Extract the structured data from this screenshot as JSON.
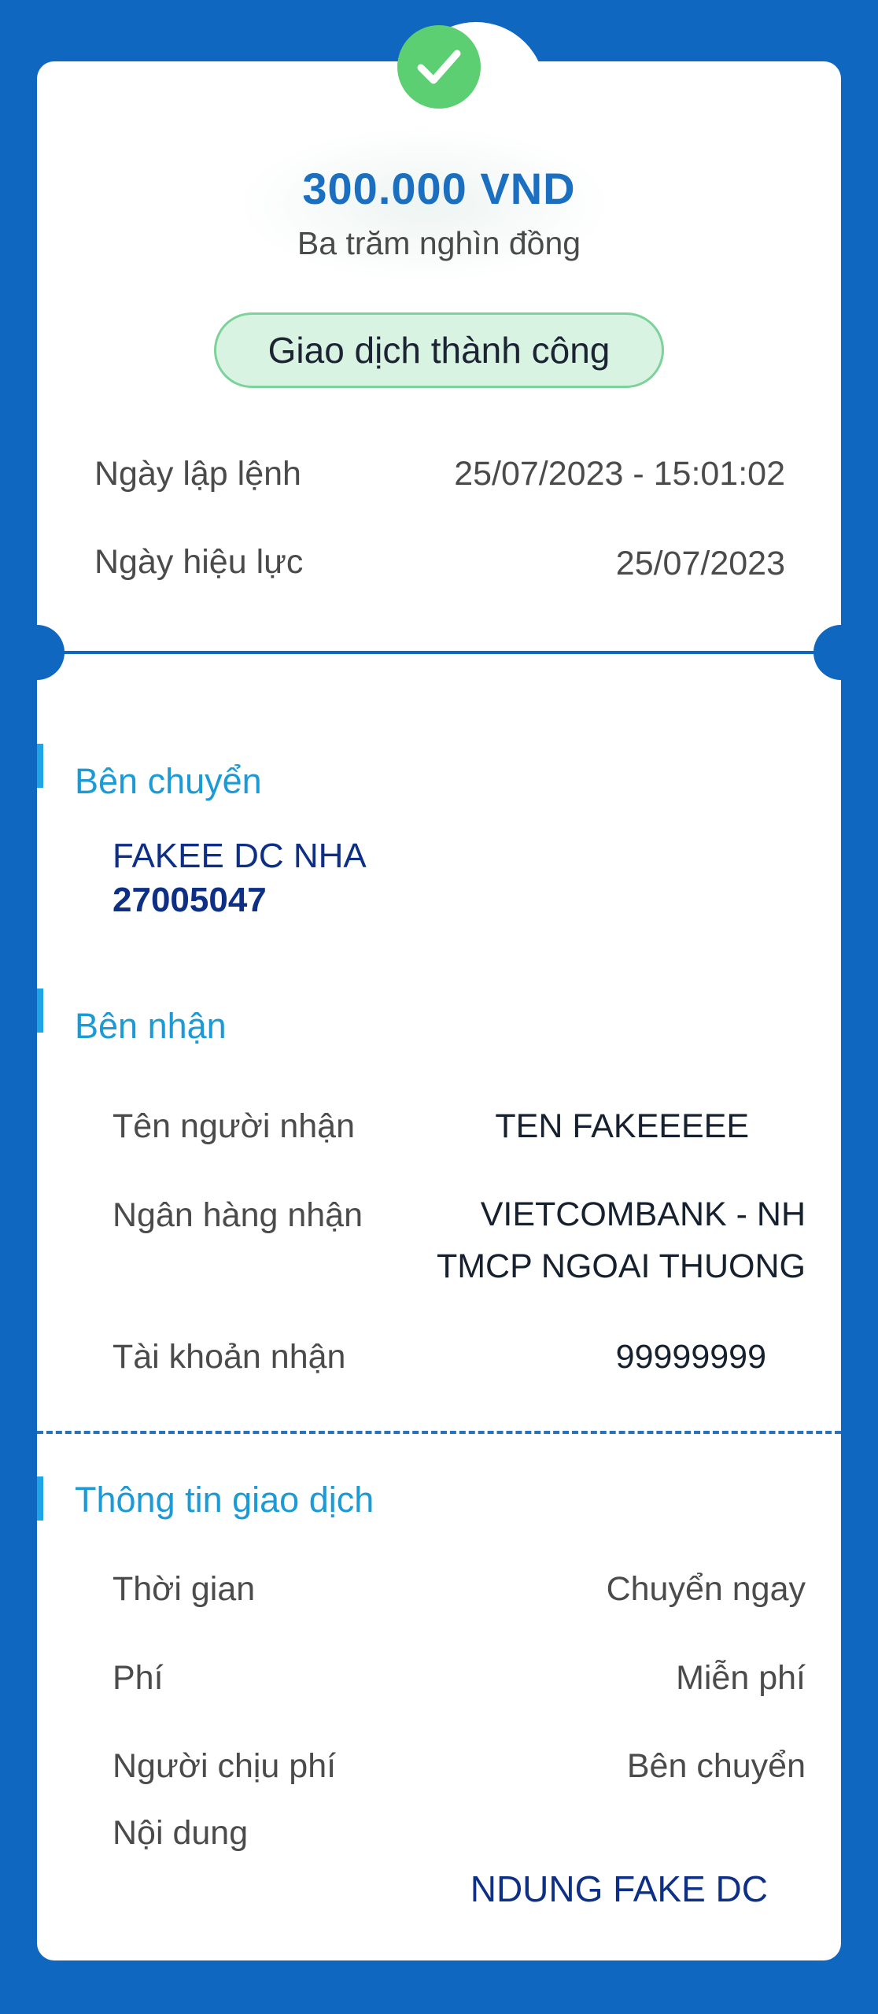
{
  "header": {
    "status_icon": "check-circle-icon",
    "amount": "300.000 VND",
    "amount_in_words": "Ba trăm nghìn đồng",
    "status_label": "Giao dịch thành công"
  },
  "dates": {
    "order_date_label": "Ngày lập lệnh",
    "order_date_value": "25/07/2023 - 15:01:02",
    "effective_date_label": "Ngày hiệu lực",
    "effective_date_value": "25/07/2023"
  },
  "sender": {
    "section_title": "Bên chuyển",
    "name": "FAKEE DC NHA",
    "account": "27005047"
  },
  "receiver": {
    "section_title": "Bên nhận",
    "name_label": "Tên người nhận",
    "name_value": "TEN FAKEEEEE",
    "bank_label": "Ngân hàng nhận",
    "bank_value_line1": "VIETCOMBANK - NH",
    "bank_value_line2": "TMCP NGOAI THUONG",
    "account_label": "Tài khoản nhận",
    "account_value": "99999999"
  },
  "transaction": {
    "section_title": "Thông tin giao dịch",
    "time_label": "Thời gian",
    "time_value": "Chuyển ngay",
    "fee_label": "Phí",
    "fee_value": "Miễn phí",
    "fee_payer_label": "Người chịu phí",
    "fee_payer_value": "Bên chuyển",
    "content_label": "Nội dung",
    "content_value": "NDUNG FAKE DC"
  },
  "colors": {
    "background": "#0f67c0",
    "amount": "#1a6fc0",
    "success": "#5ccf73",
    "section_title": "#1b9ad6",
    "account_text": "#0d2f86"
  }
}
